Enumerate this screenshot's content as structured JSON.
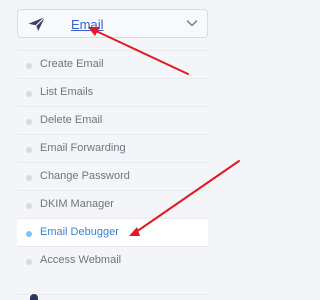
{
  "email_menu": {
    "title": "Email",
    "items": [
      {
        "label": "Create Email"
      },
      {
        "label": "List Emails"
      },
      {
        "label": "Delete Email"
      },
      {
        "label": "Email Forwarding"
      },
      {
        "label": "Change Password"
      },
      {
        "label": "DKIM Manager"
      },
      {
        "label": "Email Debugger",
        "active": true
      },
      {
        "label": "Access Webmail"
      }
    ]
  },
  "icons": {
    "header": "paper-plane-icon",
    "toggle": "chevron-down-icon",
    "bullet": "bullet-icon",
    "bottom_partial": "user-icon"
  },
  "colors": {
    "link": "#3a63c8",
    "active_label": "#3a7fd6",
    "active_bullet": "#7fc2ef",
    "annotation_arrows": "#e01b24"
  }
}
